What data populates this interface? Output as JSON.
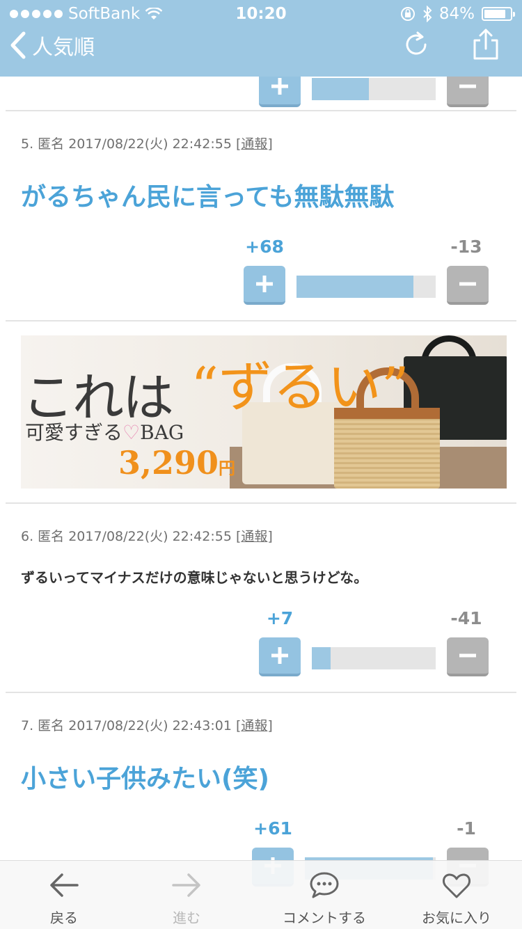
{
  "status_bar": {
    "carrier": "SoftBank",
    "time": "10:20",
    "battery": "84%",
    "battery_level": 0.84
  },
  "nav": {
    "back_label": "人気順"
  },
  "posts": [
    {
      "meta_prefix": "5. 匿名 2017/08/22(火) 22:42:55 [",
      "report": "通報",
      "meta_suffix": "]",
      "text": "がるちゃん民に言っても無駄無駄",
      "plus": "+68",
      "minus": "-13",
      "ratio": 0.84
    },
    {
      "meta_prefix": "6. 匿名 2017/08/22(火) 22:42:55 [",
      "report": "通報",
      "meta_suffix": "]",
      "text": "ずるいってマイナスだけの意味じゃないと思うけどな。",
      "plus": "+7",
      "minus": "-41",
      "ratio": 0.15
    },
    {
      "meta_prefix": "7. 匿名 2017/08/22(火) 22:43:01 [",
      "report": "通報",
      "meta_suffix": "]",
      "text": "小さい子供みたい(笑)",
      "plus": "+61",
      "minus": "-1",
      "ratio": 0.98
    }
  ],
  "previous_post": {
    "ratio": 0.46
  },
  "ad": {
    "headline_a": "これは",
    "headline_b": "“ずるい”",
    "sub_a": "可愛すぎる",
    "heart": "♡",
    "sub_b": "BAG",
    "price": "3,290",
    "yen": "円"
  },
  "toolbar": {
    "back": "戻る",
    "forward": "進む",
    "comment": "コメントする",
    "favorite": "お気に入り"
  },
  "colors": {
    "accent": "#9dc8e3",
    "link_text": "#4ba3d8",
    "minus": "#b5b5b5"
  }
}
